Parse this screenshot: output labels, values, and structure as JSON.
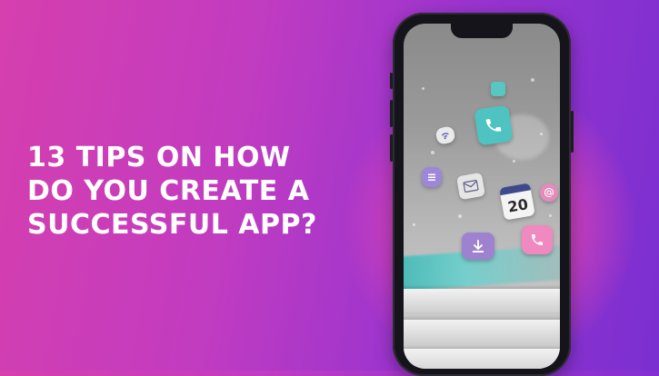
{
  "headline": {
    "lines": [
      "13 TIPS ON HOW",
      "DO YOU CREATE A",
      "SUCCESSFUL APP?"
    ]
  },
  "phone_screen": {
    "calendar_day": "20",
    "icons": [
      "phone-icon",
      "wifi-icon",
      "stack-icon",
      "mail-icon",
      "calendar-icon",
      "at-icon",
      "download-icon",
      "phone-alt-icon"
    ]
  },
  "colors": {
    "background_start": "#d63fae",
    "background_end": "#7b2fd0",
    "glow": "#f046aa",
    "headline_text": "#ffffff",
    "phone_frame": "#14141a",
    "teal_accent": "#4ec3c1",
    "purple_accent": "#9e82cf",
    "pink_accent": "#ef89c0"
  }
}
